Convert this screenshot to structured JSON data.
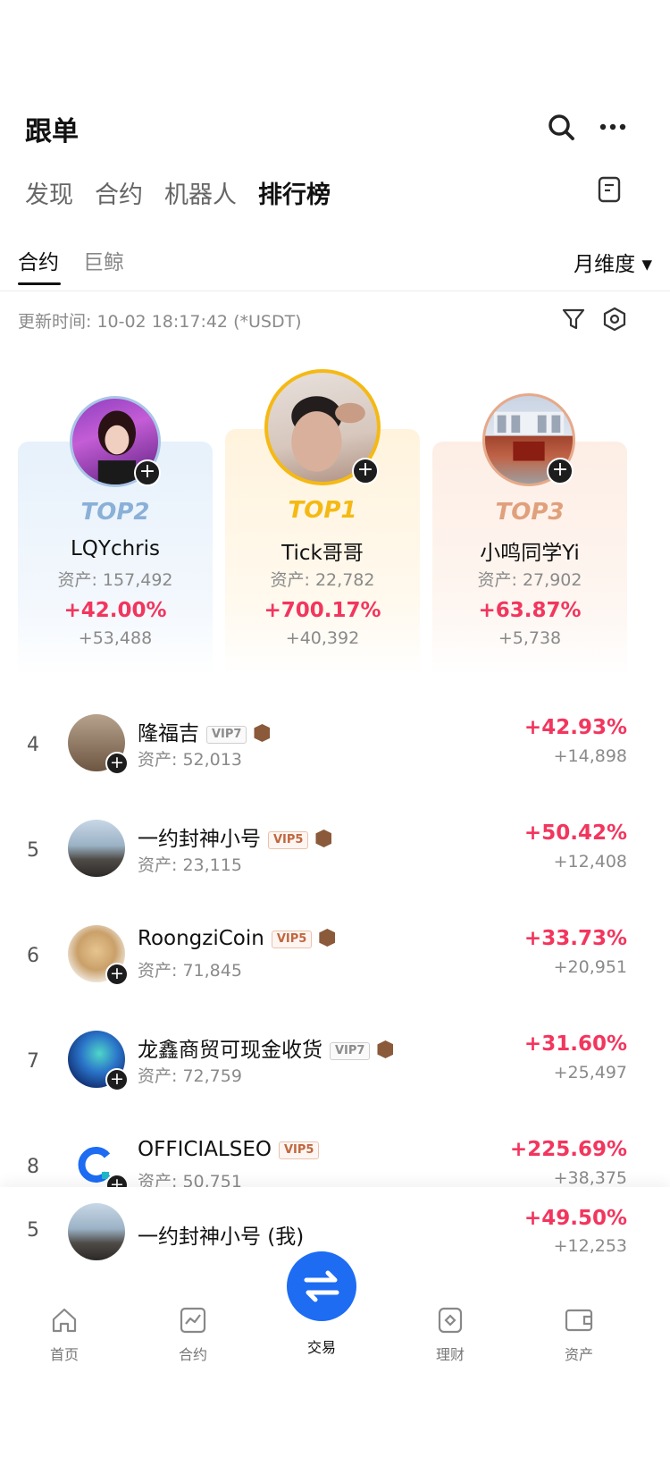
{
  "header": {
    "title": "跟单",
    "search_icon": "search-icon",
    "more_icon": "more-icon"
  },
  "main_tabs": [
    {
      "label": "发现",
      "active": false
    },
    {
      "label": "合约",
      "active": false
    },
    {
      "label": "机器人",
      "active": false
    },
    {
      "label": "排行榜",
      "active": true
    }
  ],
  "sub_tabs": [
    {
      "label": "合约",
      "active": true
    },
    {
      "label": "巨鲸",
      "active": false
    }
  ],
  "period_selector": {
    "label": "月维度 ▾"
  },
  "update_info": {
    "text": "更新时间: 10-02 18:17:42 (*USDT)"
  },
  "podium": {
    "top2": {
      "rank_label": "TOP2",
      "name": "LQYchris",
      "asset": "资产: 157,492",
      "pct": "+42.00%",
      "amount": "+53,488",
      "color": "#8ab0d8"
    },
    "top1": {
      "rank_label": "TOP1",
      "name": "Tick哥哥",
      "asset": "资产: 22,782",
      "pct": "+700.17%",
      "amount": "+40,392",
      "color": "#f5b914"
    },
    "top3": {
      "rank_label": "TOP3",
      "name": "小鸣同学Yi",
      "asset": "资产: 27,902",
      "pct": "+63.87%",
      "amount": "+5,738",
      "color": "#e0a07c"
    }
  },
  "list": [
    {
      "rank": "4",
      "name": "隆福吉",
      "vip": "VIP7",
      "asset": "资产: 52,013",
      "pct": "+42.93%",
      "amount": "+14,898"
    },
    {
      "rank": "5",
      "name": "一约封神小号",
      "vip": "VIP5",
      "asset": "资产: 23,115",
      "pct": "+50.42%",
      "amount": "+12,408"
    },
    {
      "rank": "6",
      "name": "RoongziCoin",
      "vip": "VIP5",
      "asset": "资产: 71,845",
      "pct": "+33.73%",
      "amount": "+20,951"
    },
    {
      "rank": "7",
      "name": "龙鑫商贸可现金收货",
      "vip": "VIP7",
      "asset": "资产: 72,759",
      "pct": "+31.60%",
      "amount": "+25,497"
    },
    {
      "rank": "8",
      "name": "OFFICIALSEO",
      "vip": "VIP5",
      "asset": "资产: 50,751",
      "pct": "+225.69%",
      "amount": "+38,375"
    }
  ],
  "my_rank": {
    "rank": "5",
    "name": "一约封神小号 (我)",
    "pct": "+49.50%",
    "amount": "+12,253"
  },
  "bottom_nav": [
    {
      "label": "首页",
      "icon": "home-icon",
      "active": false
    },
    {
      "label": "合约",
      "icon": "contract-icon",
      "active": false
    },
    {
      "label": "交易",
      "icon": "swap-icon",
      "active": true
    },
    {
      "label": "理财",
      "icon": "finance-icon",
      "active": false
    },
    {
      "label": "资产",
      "icon": "wallet-icon",
      "active": false
    }
  ],
  "colors": {
    "accent": "#1d6cf2",
    "up": "#f2365e",
    "muted": "#8a8a8a"
  }
}
